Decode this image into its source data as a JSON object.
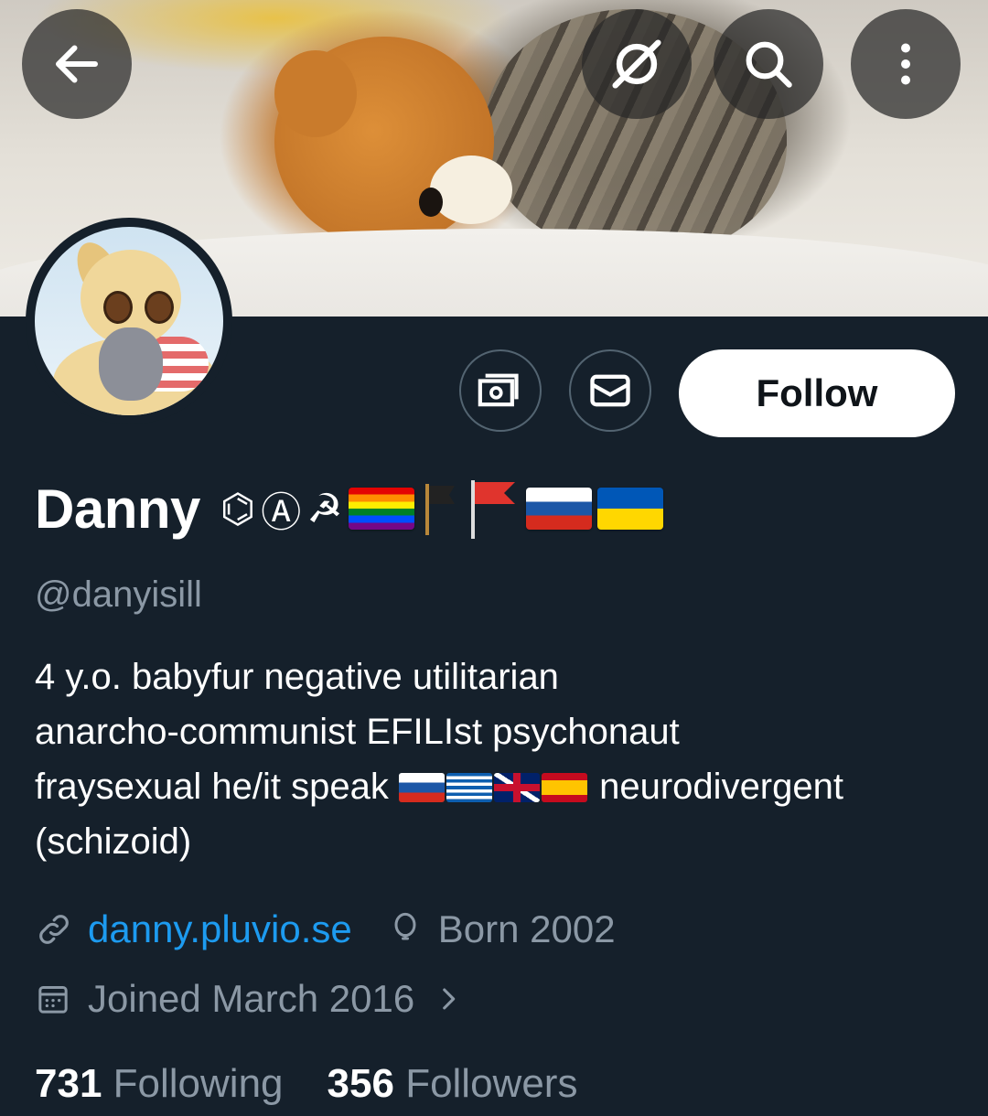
{
  "header": {
    "back_icon": "arrow-left-icon",
    "grok_icon": "grok-icon",
    "search_icon": "search-icon",
    "more_icon": "more-vertical-icon"
  },
  "actions": {
    "tip_icon": "money-icon",
    "message_icon": "envelope-icon",
    "follow_label": "Follow"
  },
  "profile": {
    "name": "Danny",
    "name_emoji": [
      "⌬",
      "Ⓐ",
      "☭"
    ],
    "name_flags": [
      "rainbow-flag",
      "black-flag",
      "red-flag",
      "russia-flag",
      "ukraine-flag"
    ],
    "handle": "@danyisill",
    "bio": {
      "line1": "4 y.o. babyfur negative utilitarian",
      "line2": "anarcho-communist EFILIst psychonaut",
      "line3_pre": "fraysexual he/it speak",
      "line3_flags": [
        "russia-flag",
        "greece-flag",
        "uk-flag",
        "spain-flag"
      ],
      "line3_post": "neurodivergent",
      "line4": "(schizoid)"
    },
    "website": "danny.pluvio.se",
    "birth": "Born 2002",
    "joined": "Joined March 2016"
  },
  "stats": {
    "following_count": "731",
    "following_label": "Following",
    "followers_count": "356",
    "followers_label": "Followers"
  },
  "colors": {
    "background": "#15202b",
    "secondary_text": "#8b98a5",
    "link": "#1d9bf0",
    "border": "#536471"
  }
}
